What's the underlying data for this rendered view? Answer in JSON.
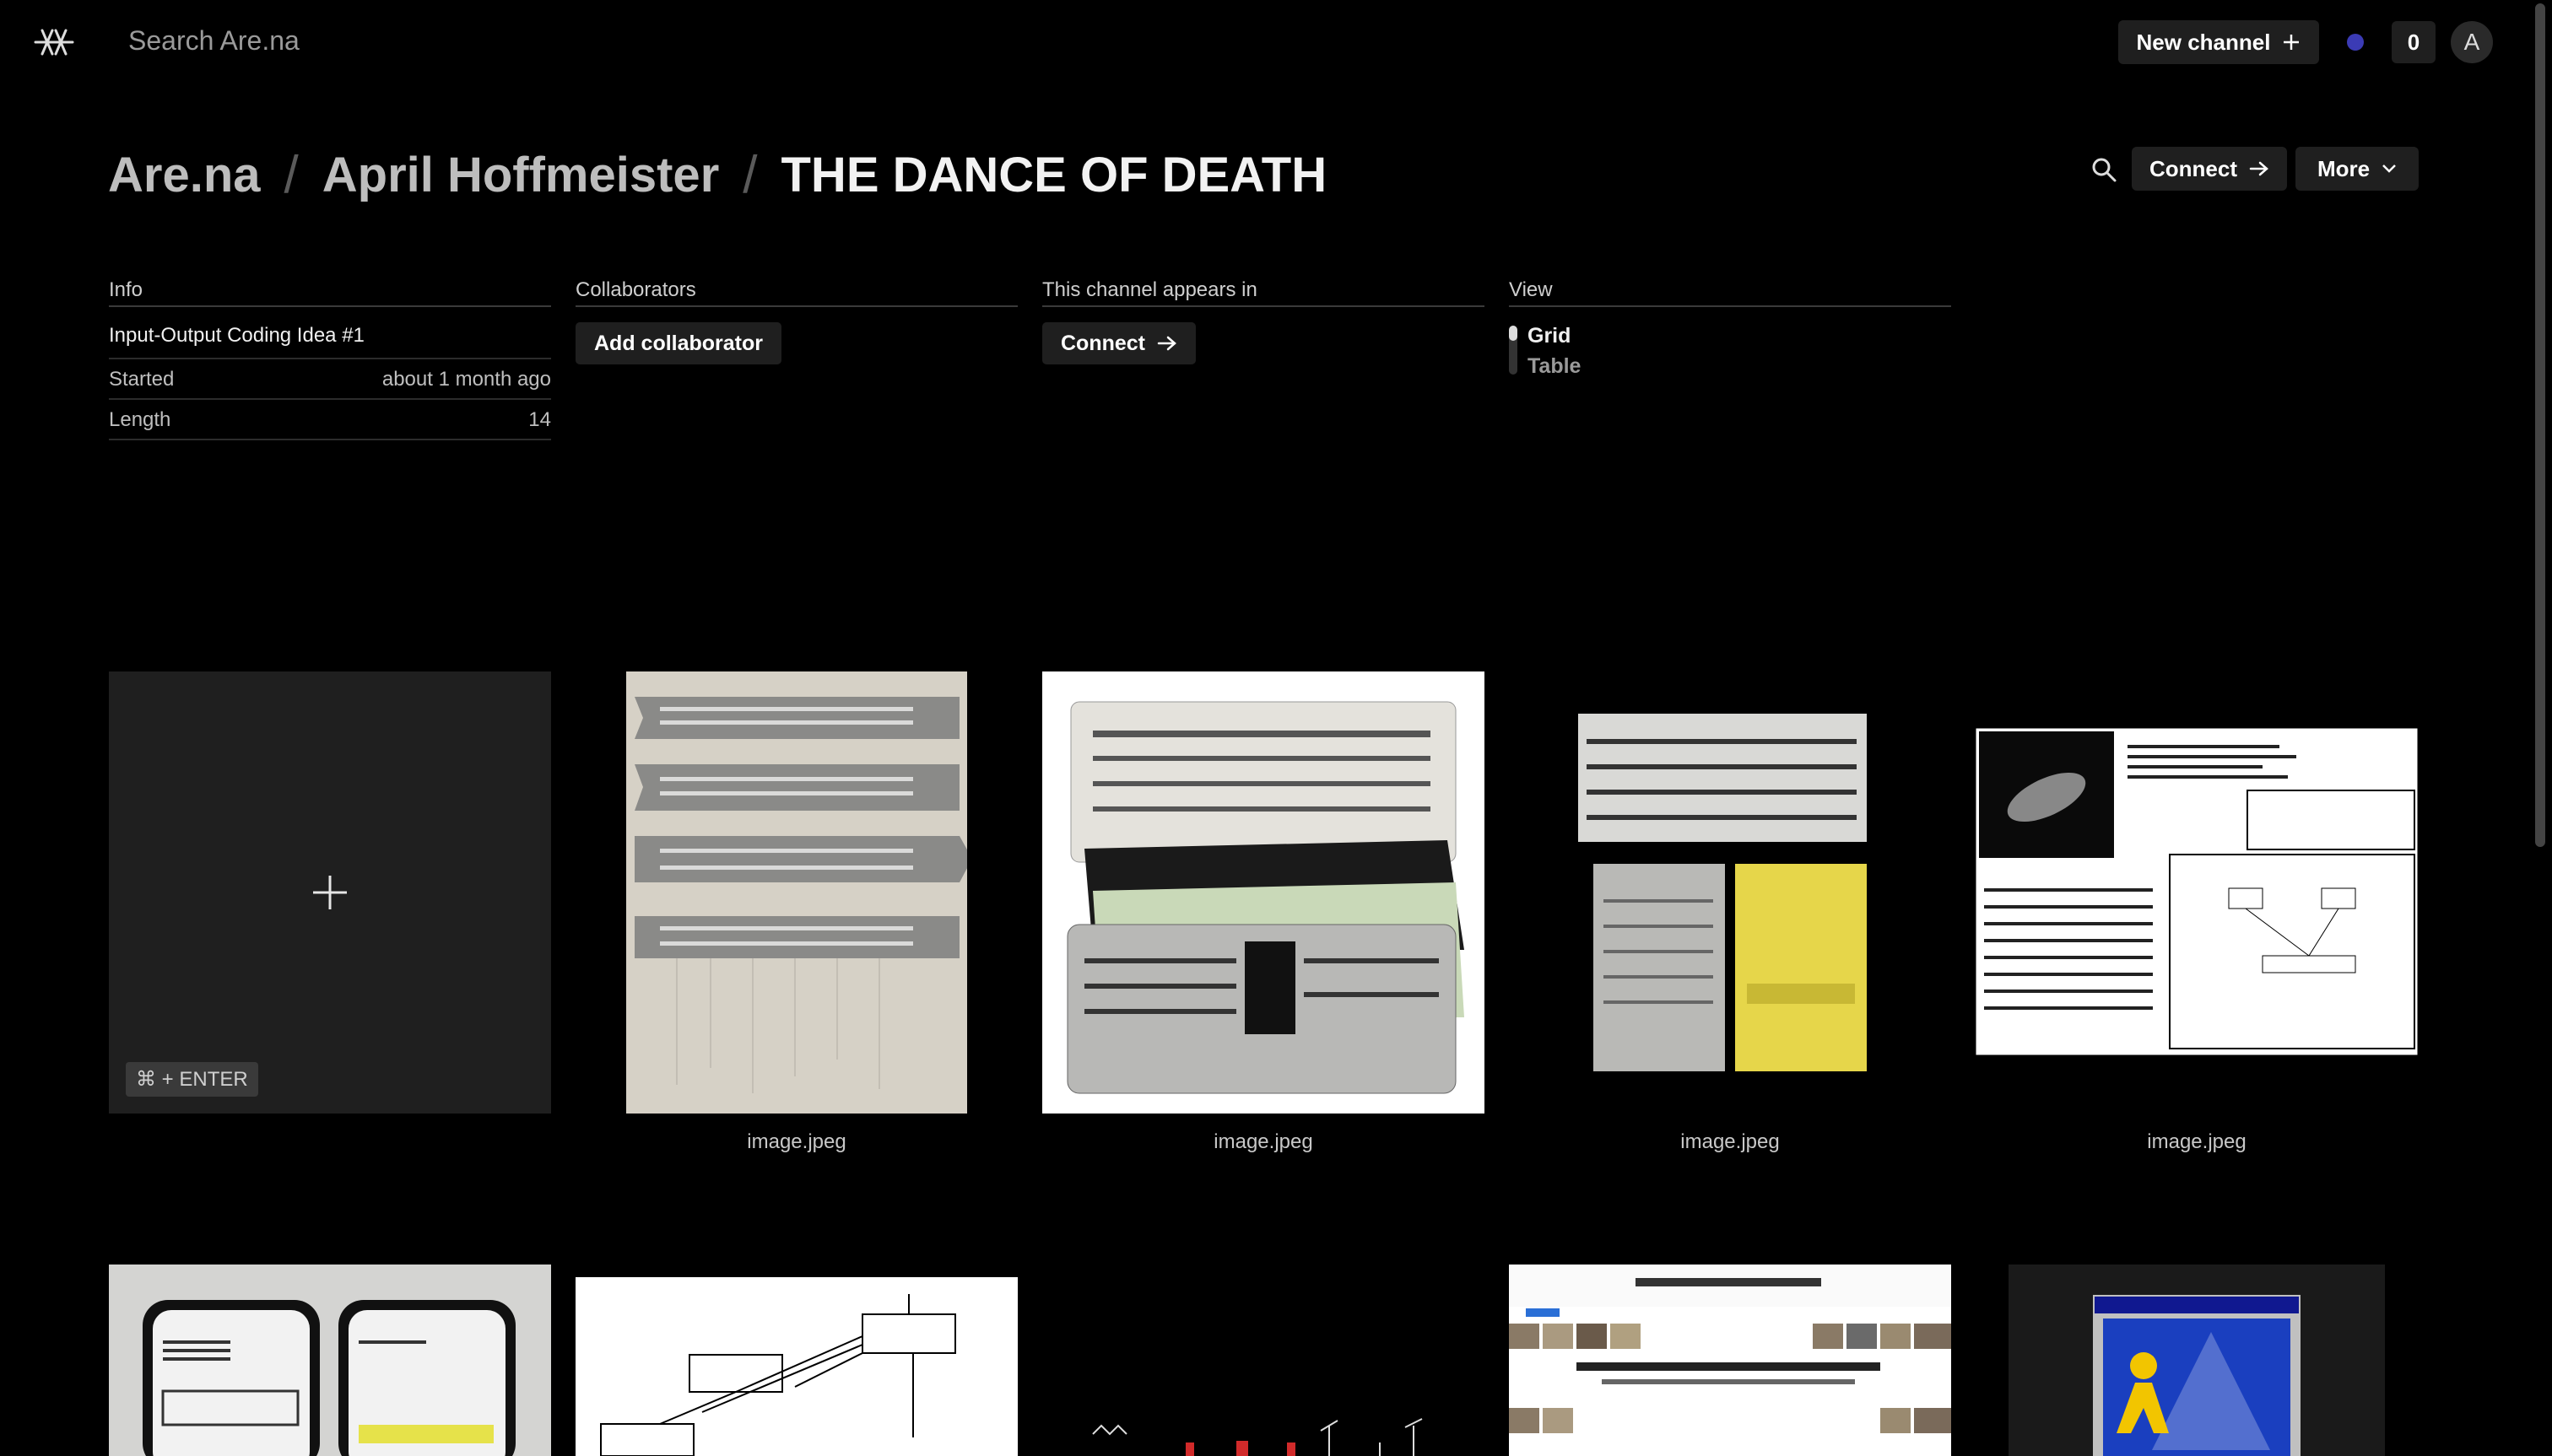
{
  "header": {
    "search_placeholder": "Search Are.na",
    "new_channel_label": "New channel",
    "notification_count": "0",
    "avatar_initial": "A"
  },
  "breadcrumb": {
    "root": "Are.na",
    "user": "April Hoffmeister",
    "channel": "THE DANCE OF DEATH",
    "separator": "/"
  },
  "actions": {
    "connect_label": "Connect",
    "more_label": "More"
  },
  "info": {
    "heading": "Info",
    "title": "Input-Output Coding Idea #1",
    "rows": [
      {
        "label": "Started",
        "value": "about 1 month ago"
      },
      {
        "label": "Length",
        "value": "14"
      }
    ]
  },
  "collaborators": {
    "heading": "Collaborators",
    "button_label": "Add collaborator"
  },
  "appears_in": {
    "heading": "This channel appears in",
    "button_label": "Connect"
  },
  "view": {
    "heading": "View",
    "options": [
      "Grid",
      "Table"
    ],
    "selected": "Grid"
  },
  "add_block": {
    "shortcut": "⌘ + ENTER"
  },
  "blocks": [
    {
      "caption": "image.jpeg"
    },
    {
      "caption": "image.jpeg"
    },
    {
      "caption": "image.jpeg"
    },
    {
      "caption": "image.jpeg"
    }
  ],
  "colors": {
    "background": "#000000",
    "button": "#1f1f1f",
    "status_dot": "#3b3bb5",
    "add_block_bg": "#1f1f1f"
  },
  "icons": [
    "are-na-logo-icon",
    "plus-icon",
    "arrow-right-icon",
    "chevron-down-icon",
    "search-icon"
  ]
}
